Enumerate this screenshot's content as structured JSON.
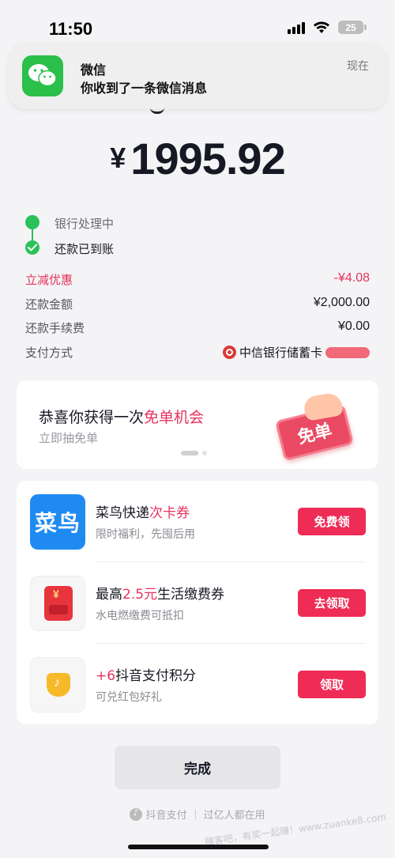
{
  "status_bar": {
    "time": "11:50",
    "battery": "25"
  },
  "notification": {
    "app": "微信",
    "message": "你收到了一条微信消息",
    "time": "现在",
    "icon": "wechat-icon"
  },
  "amount": {
    "currency": "¥",
    "value": "1995.92"
  },
  "timeline": [
    {
      "label": "银行处理中"
    },
    {
      "label": "还款已到账"
    }
  ],
  "details": [
    {
      "key": "立减优惠",
      "value": "-¥4.08"
    },
    {
      "key": "还款金额",
      "value": "¥2,000.00"
    },
    {
      "key": "还款手续费",
      "value": "¥0.00"
    },
    {
      "key": "支付方式",
      "value": "中信银行储蓄卡"
    }
  ],
  "promo": {
    "title_prefix": "恭喜你获得一次",
    "title_highlight": "免单机会",
    "subtitle": "立即抽免单",
    "badge": "免单"
  },
  "coupons": [
    {
      "title_prefix": "菜鸟快递",
      "title_highlight": "次卡券",
      "title_suffix": "",
      "subtitle": "限时福利，先囤后用",
      "button": "免费领",
      "icon_text": "菜鸟",
      "icon": "cainiao-icon"
    },
    {
      "title_prefix": "最高",
      "title_highlight": "2.5元",
      "title_suffix": "生活缴费券",
      "subtitle": "水电燃缴费可抵扣",
      "button": "去领取",
      "icon": "bill-coupon-icon"
    },
    {
      "title_prefix": "",
      "title_highlight": "+6",
      "title_suffix": "抖音支付积分",
      "subtitle": "可兑红包好礼",
      "button": "领取",
      "icon": "douyin-points-icon"
    }
  ],
  "done_button": "完成",
  "footer": {
    "brand": "抖音支付",
    "slogan": "过亿人都在用"
  },
  "watermark": "赚客吧，有奖一起赚！www.zuanke8.com",
  "colors": {
    "accent": "#ee2c55",
    "success": "#2bc15a",
    "wechat": "#2ac04a"
  }
}
